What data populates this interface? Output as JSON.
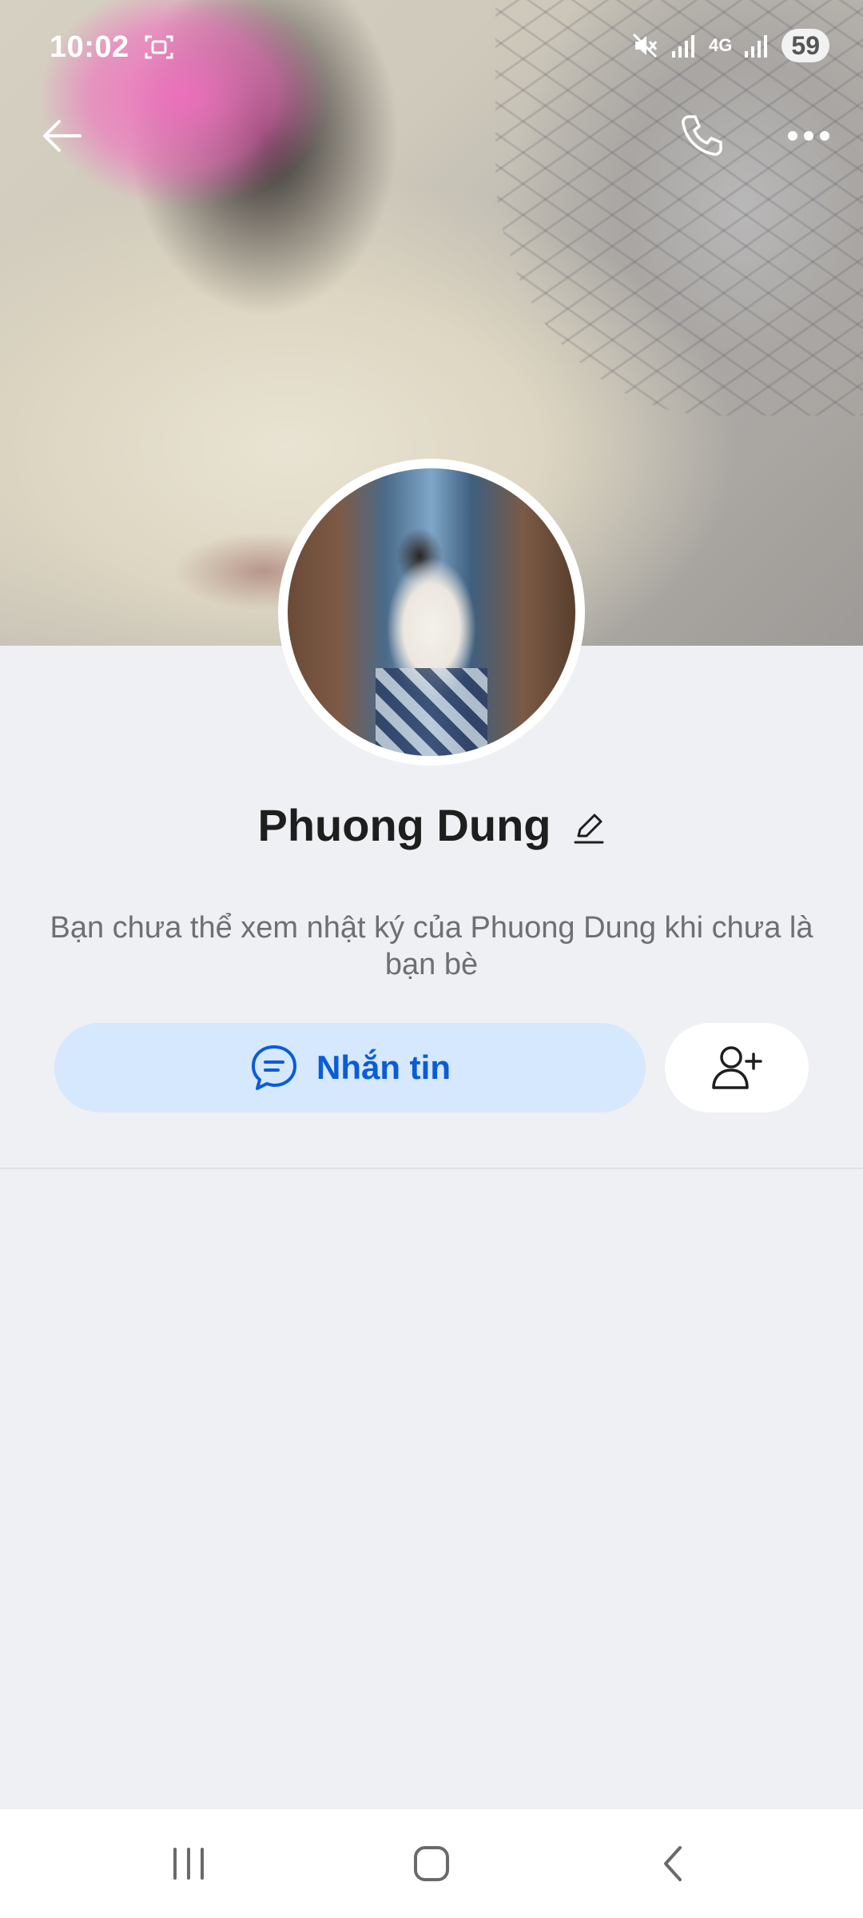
{
  "status_bar": {
    "time": "10:02",
    "network": "4G",
    "battery": "59"
  },
  "profile": {
    "name": "Phuong Dung",
    "notice": "Bạn chưa thể xem nhật ký của Phuong Dung khi chưa là bạn bè"
  },
  "actions": {
    "message_label": "Nhắn tin"
  },
  "colors": {
    "accent": "#0a5cd8",
    "message_button_bg": "#d6e8fe",
    "page_bg": "#eff0f4"
  },
  "icons": {
    "back": "back-arrow-icon",
    "call": "phone-icon",
    "more": "more-icon",
    "edit": "pencil-icon",
    "message": "chat-bubble-icon",
    "add_friend": "add-user-icon"
  }
}
